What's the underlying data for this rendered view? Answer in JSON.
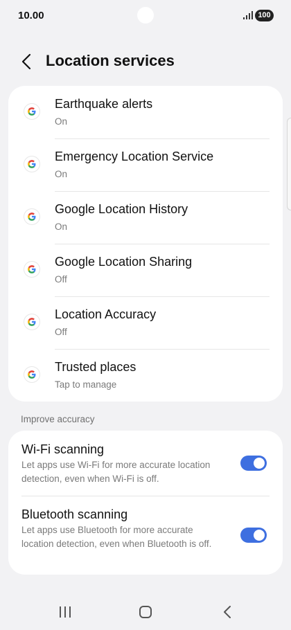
{
  "status": {
    "time": "10.00",
    "battery": "100",
    "icons": [
      "signal-icon",
      "battery-icon"
    ]
  },
  "header": {
    "title": "Location services",
    "back_icon": "back-arrow-icon"
  },
  "services": [
    {
      "title": "Earthquake alerts",
      "subtitle": "On",
      "icon": "google-icon"
    },
    {
      "title": "Emergency Location Service",
      "subtitle": "On",
      "icon": "google-icon"
    },
    {
      "title": "Google Location History",
      "subtitle": "On",
      "icon": "google-icon"
    },
    {
      "title": "Google Location Sharing",
      "subtitle": "Off",
      "icon": "google-icon"
    },
    {
      "title": "Location Accuracy",
      "subtitle": "Off",
      "icon": "google-icon"
    },
    {
      "title": "Trusted places",
      "subtitle": "Tap to manage",
      "icon": "google-icon"
    }
  ],
  "improve": {
    "section_label": "Improve accuracy",
    "items": [
      {
        "title": "Wi-Fi scanning",
        "description": "Let apps use Wi-Fi for more accurate location detection, even when Wi-Fi is off.",
        "enabled": true
      },
      {
        "title": "Bluetooth scanning",
        "description": "Let apps use Bluetooth for more accurate location detection, even when Bluetooth is off.",
        "enabled": true
      }
    ]
  },
  "colors": {
    "toggle_on": "#3e6fe0",
    "background": "#f2f2f4",
    "card": "#ffffff"
  },
  "nav": {
    "icons": [
      "recent-apps-icon",
      "home-icon",
      "back-icon"
    ]
  }
}
